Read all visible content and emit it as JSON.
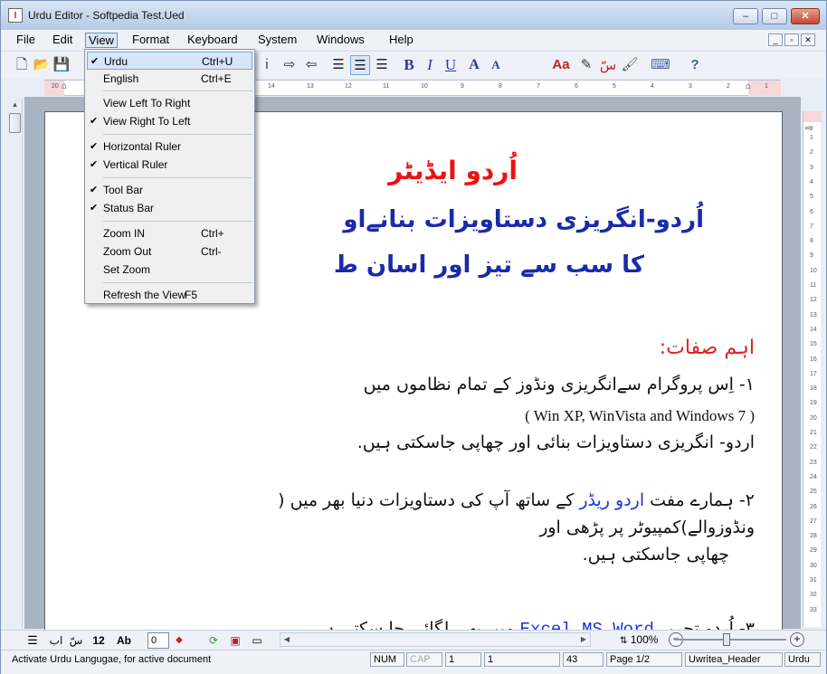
{
  "window": {
    "title": "Urdu Editor - Softpedia Test.Ued",
    "app_icon": "urdu-editor-app-icon",
    "min": "–",
    "max": "□",
    "close": "✕"
  },
  "menubar": {
    "items": [
      "File",
      "Edit",
      "View",
      "Format",
      "Keyboard",
      "System",
      "Windows",
      "Help"
    ],
    "active": "View"
  },
  "toolbar": {
    "font_size": "28"
  },
  "view_menu": {
    "items": [
      {
        "label": "Urdu",
        "shortcut": "Ctrl+U",
        "checked": true,
        "highlighted": true
      },
      {
        "label": "English",
        "shortcut": "Ctrl+E",
        "checked": false
      },
      {
        "label": "View Left To Right",
        "shortcut": "",
        "checked": false
      },
      {
        "label": "View Right To Left",
        "shortcut": "",
        "checked": true
      },
      {
        "label": "Horizontal Ruler",
        "shortcut": "",
        "checked": true
      },
      {
        "label": "Vertical Ruler",
        "shortcut": "",
        "checked": true
      },
      {
        "label": "Tool Bar",
        "shortcut": "",
        "checked": true
      },
      {
        "label": "Status Bar",
        "shortcut": "",
        "checked": true
      },
      {
        "label": "Zoom IN",
        "shortcut": "Ctrl+",
        "checked": false
      },
      {
        "label": "Zoom Out",
        "shortcut": "Ctrl-",
        "checked": false
      },
      {
        "label": "Set Zoom",
        "shortcut": "",
        "checked": false
      },
      {
        "label": "Refresh the View",
        "shortcut": "F5",
        "checked": false
      }
    ]
  },
  "document": {
    "title_line": "اُردو ایڈیٹر",
    "heading_line1": "اُردو-انگریزی دستاویزات بنانےاو",
    "heading_line2": "کا سب سے تیز اور اسان ط",
    "features_heading": "اہم صفات:",
    "p1_line1": "۱- اِس پروگرام سےانگریزی ونڈوز کے تمام نظاموں میں",
    "p1_line2": "( Win XP,  WinVista and Windows 7 )",
    "p1_line3": "اردو- انگریزی دستاویزات بنائی اور چھاپی جاسکتی ہیں.",
    "p2_line1_a": "۲- ہمارے مفت",
    "p2_line1_link": "اردو ریڈر",
    "p2_line1_b": "کے ساتھ آپ کی دستاویزات دنیا بھر میں (",
    "p2_line2": "ونڈوزوالے)کمپیوٹر پر پڑھی اور",
    "p2_line3": "چھاپی جاسکتی ہیں.",
    "p3_partial_a": "۳- اُردو تحریر",
    "p3_partial_link": "Excel MS Word",
    "p3_partial_b": "میں بھی لگائی جا سکتی ہے"
  },
  "hruler": {
    "labels": [
      "20",
      "19",
      "18",
      "17",
      "16",
      "15",
      "14",
      "13",
      "12",
      "11",
      "10",
      "9",
      "8",
      "7",
      "6",
      "5",
      "4",
      "3",
      "2",
      "1"
    ]
  },
  "vruler": {
    "labels": [
      "1",
      "2",
      "3",
      "4",
      "5",
      "6",
      "7",
      "8",
      "9",
      "10",
      "11",
      "12",
      "13",
      "14",
      "15",
      "16",
      "17",
      "18",
      "19",
      "20",
      "21",
      "22",
      "23",
      "24",
      "25",
      "26",
      "27",
      "28",
      "29",
      "30",
      "31",
      "32",
      "33",
      "34"
    ]
  },
  "format_bar": {
    "labels": [
      "اب",
      "سّ",
      "12",
      "Ab"
    ],
    "spin_value": "0"
  },
  "zoom": {
    "value": "100%"
  },
  "statusbar": {
    "message": "Activate Urdu Langugae, for active document",
    "num": "NUM",
    "cap": "CAP",
    "line": "1",
    "col": "1",
    "chars": "43",
    "page": "Page 1/2",
    "style": "Uwritea_Header",
    "lang": "Urdu"
  }
}
